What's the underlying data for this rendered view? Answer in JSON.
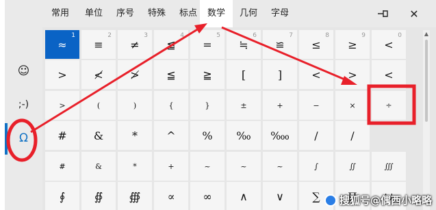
{
  "sidebar": {
    "items": [
      {
        "label": "☺",
        "name": "emoji-icon"
      },
      {
        "label": ";-)",
        "name": "kaomoji-icon"
      },
      {
        "label": "Ω",
        "name": "symbols-icon"
      }
    ]
  },
  "tabs": [
    {
      "label": "常用"
    },
    {
      "label": "单位"
    },
    {
      "label": "序号"
    },
    {
      "label": "特殊"
    },
    {
      "label": "标点"
    },
    {
      "label": "数学"
    },
    {
      "label": "几何"
    },
    {
      "label": "字母"
    }
  ],
  "active_tab": 5,
  "window": {
    "pin_icon": "⊣⊢",
    "close_icon": "✕"
  },
  "grid": [
    [
      {
        "s": "≈",
        "n": "1"
      },
      {
        "s": "≡",
        "n": "2"
      },
      {
        "s": "≠",
        "n": "3"
      },
      {
        "s": "≦",
        "n": "4"
      },
      {
        "s": "=",
        "n": "5"
      },
      {
        "s": "≒",
        "n": "6"
      },
      {
        "s": "≌",
        "n": "7"
      },
      {
        "s": "≤",
        "n": "8"
      },
      {
        "s": "≥",
        "n": "9"
      },
      {
        "s": "<",
        "n": "0"
      }
    ],
    [
      {
        "s": ">"
      },
      {
        "s": "≮"
      },
      {
        "s": "≯"
      },
      {
        "s": "≦"
      },
      {
        "s": "≧"
      },
      {
        "s": "["
      },
      {
        "s": "]"
      },
      {
        "s": "<"
      },
      {
        "s": ">"
      },
      {
        "s": "<"
      }
    ],
    [
      {
        "s": ">"
      },
      {
        "s": "("
      },
      {
        "s": ")"
      },
      {
        "s": "{"
      },
      {
        "s": "}"
      },
      {
        "s": "±"
      },
      {
        "s": "+"
      },
      {
        "s": "−"
      },
      {
        "s": "×"
      },
      {
        "s": "÷"
      }
    ],
    [
      {
        "s": "#"
      },
      {
        "s": "&"
      },
      {
        "s": "*"
      },
      {
        "s": "^"
      },
      {
        "s": "%"
      },
      {
        "s": "‰"
      },
      {
        "s": "‱"
      },
      {
        "s": "/"
      },
      {
        "s": "/"
      }
    ],
    [
      {
        "s": "#"
      },
      {
        "s": "&"
      },
      {
        "s": "*"
      },
      {
        "s": "+"
      },
      {
        "s": "~"
      },
      {
        "s": "~"
      },
      {
        "s": "~"
      },
      {
        "s": "∫"
      },
      {
        "s": "∬"
      },
      {
        "s": "∭"
      }
    ],
    [
      {
        "s": "∮"
      },
      {
        "s": "∯"
      },
      {
        "s": "∰"
      },
      {
        "s": "∝"
      },
      {
        "s": "∞"
      },
      {
        "s": "∧"
      },
      {
        "s": "∨"
      },
      {
        "s": "∑"
      },
      {
        "s": "∏"
      },
      {
        "s": "∪"
      }
    ]
  ],
  "watermark": {
    "text": "搜狐号@偶西小略略"
  },
  "colors": {
    "accent": "#1172c4",
    "selected_cell": "#0a63c5",
    "annotation_red": "#e8202a"
  }
}
